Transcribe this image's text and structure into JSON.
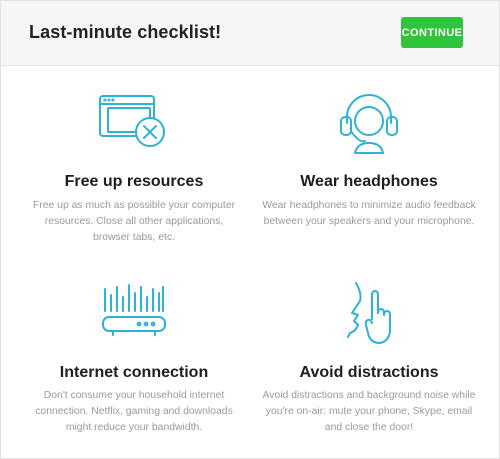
{
  "header": {
    "title": "Last-minute checklist!",
    "continue_label": "CONTINUE"
  },
  "accent_colors": {
    "icon_stroke": "#2fb2d6",
    "button": "#2ec53a"
  },
  "items": [
    {
      "icon": "browser-close-icon",
      "title": "Free up resources",
      "description": "Free up as much as possible your computer resources. Close all other applications, browser tabs, etc."
    },
    {
      "icon": "headphones-icon",
      "title": "Wear headphones",
      "description": "Wear headphones to minimize audio feedback between your speakers and your microphone."
    },
    {
      "icon": "router-icon",
      "title": "Internet connection",
      "description": "Don't consume your household internet connection. Netflix, gaming and downloads might reduce your bandwidth."
    },
    {
      "icon": "shush-icon",
      "title": "Avoid distractions",
      "description": "Avoid distractions and background noise while you're on-air: mute your phone, Skype, email and close the door!"
    }
  ]
}
